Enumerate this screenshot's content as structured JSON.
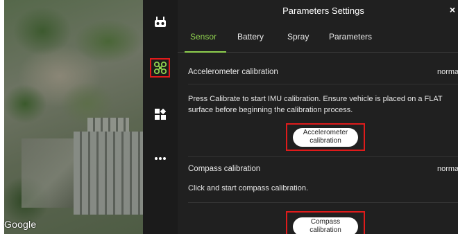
{
  "map": {
    "attribution": "Google"
  },
  "header": {
    "title": "Parameters Settings",
    "close_symbol": "×"
  },
  "rail": {
    "icons": [
      "remote-controller-icon",
      "drone-icon",
      "apps-grid-icon",
      "more-icon"
    ]
  },
  "tabs": [
    {
      "label": "Sensor",
      "active": true
    },
    {
      "label": "Battery",
      "active": false
    },
    {
      "label": "Spray",
      "active": false
    },
    {
      "label": "Parameters",
      "active": false
    }
  ],
  "accelerometer": {
    "label": "Accelerometer calibration",
    "status": "norma",
    "description": "Press Calibrate to start IMU calibration. Ensure vehicle is placed on a FLAT surface before beginning the calibration process.",
    "button_line1": "Accelerometer",
    "button_line2": "calibration"
  },
  "compass": {
    "label": "Compass calibration",
    "status": "norma",
    "description": "Click and start compass calibration.",
    "button_line1": "Compass",
    "button_line2": "calibration"
  },
  "colors": {
    "accent": "#8fd14f",
    "highlight": "#e01b1b",
    "panel": "#202020",
    "rail": "#1b1b1b"
  }
}
